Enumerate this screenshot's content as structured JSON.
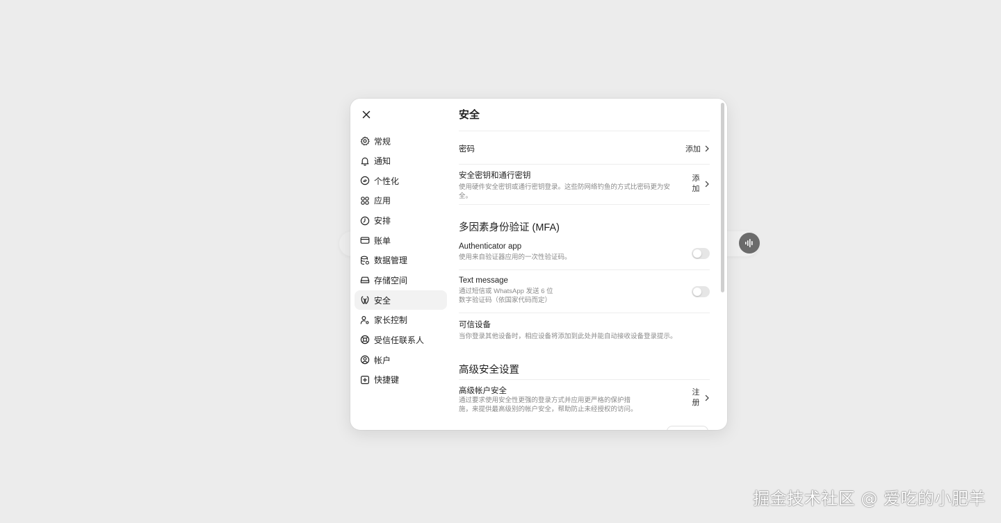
{
  "dialog": {
    "page_title": "安全"
  },
  "sidebar": {
    "items": [
      {
        "label": "常规",
        "icon": "gear-icon"
      },
      {
        "label": "通知",
        "icon": "bell-icon"
      },
      {
        "label": "个性化",
        "icon": "palette-icon"
      },
      {
        "label": "应用",
        "icon": "apps-grid-icon"
      },
      {
        "label": "安排",
        "icon": "clock-icon"
      },
      {
        "label": "账单",
        "icon": "credit-card-icon"
      },
      {
        "label": "数据管理",
        "icon": "database-icon"
      },
      {
        "label": "存储空间",
        "icon": "storage-drive-icon"
      },
      {
        "label": "安全",
        "icon": "shield-icon",
        "active": true
      },
      {
        "label": "家长控制",
        "icon": "parental-control-icon"
      },
      {
        "label": "受信任联系人",
        "icon": "lifebuoy-icon"
      },
      {
        "label": "帐户",
        "icon": "user-circle-icon"
      },
      {
        "label": "快捷键",
        "icon": "keyboard-shortcut-icon"
      }
    ]
  },
  "security": {
    "password": {
      "title": "密码",
      "action": "添加"
    },
    "passkeys": {
      "title": "安全密钥和通行密钥",
      "desc": "使用硬件安全密钥或通行密钥登录。这些防网络钓鱼的方式比密码更为安全。",
      "action_line1": "添",
      "action_line2": "加"
    }
  },
  "mfa": {
    "heading": "多因素身份验证 (MFA)",
    "authenticator": {
      "title": "Authenticator app",
      "desc": "使用来自验证器应用的一次性验证码。",
      "enabled": false
    },
    "text_message": {
      "title": "Text message",
      "desc_line1": "通过短信或 WhatsApp 发送 6 位",
      "desc_line2": "数字验证码（依国家代码而定）",
      "enabled": false
    },
    "trusted_devices": {
      "title": "可信设备",
      "desc": "当你登录其他设备时，相应设备将添加到此处并能自动接收设备登录提示。"
    }
  },
  "advanced": {
    "heading": "高级安全设置",
    "account_security": {
      "title": "高级帐户安全",
      "desc_line1": "通过要求使用安全性更强的登录方式并应用更严格的保护措",
      "desc_line2": "施，来提供最高级别的帐户安全，帮助防止未经授权的访问。",
      "action_line1": "注",
      "action_line2": "册"
    }
  },
  "watermark": "掘金技术社区 @ 爱吃的小肥羊",
  "colors": {
    "background": "#ececec",
    "dialog": "#ffffff",
    "active_item": "#f2f2f2",
    "toggle_off": "#e6e6e6",
    "muted_text": "#8a8a8a"
  }
}
